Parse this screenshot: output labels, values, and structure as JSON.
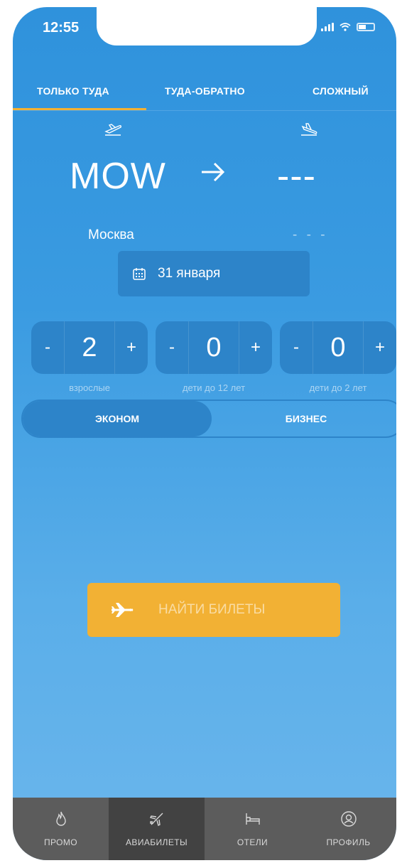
{
  "status_bar": {
    "time": "12:55"
  },
  "tabs": [
    {
      "label": "ТОЛЬКО ТУДА",
      "active": true
    },
    {
      "label": "ТУДА-ОБРАТНО",
      "active": false
    },
    {
      "label": "СЛОЖНЫЙ",
      "active": false
    }
  ],
  "route": {
    "origin_code": "MOW",
    "destination_code": "---",
    "origin_city": "Москва",
    "destination_city": "- - -"
  },
  "date": {
    "label": "31 января"
  },
  "passengers": [
    {
      "minus": "-",
      "value": "2",
      "plus": "+",
      "label": "взрослые"
    },
    {
      "minus": "-",
      "value": "0",
      "plus": "+",
      "label": "дети до 12 лет"
    },
    {
      "minus": "-",
      "value": "0",
      "plus": "+",
      "label": "дети до 2 лет"
    }
  ],
  "travel_class": {
    "econom": "ЭКОНОМ",
    "business": "БИЗНЕС",
    "selected": "econom"
  },
  "search_button": {
    "label": "НАЙТИ БИЛЕТЫ"
  },
  "bottom_nav": [
    {
      "label": "ПРОМО",
      "icon": "fire-icon",
      "active": false
    },
    {
      "label": "АВИАБИЛЕТЫ",
      "icon": "airplane-icon",
      "active": true
    },
    {
      "label": "ОТЕЛИ",
      "icon": "bed-icon",
      "active": false
    },
    {
      "label": "ПРОФИЛЬ",
      "icon": "user-circle-icon",
      "active": false
    }
  ],
  "colors": {
    "background_top": "#2f92dc",
    "background_bottom": "#6bb6ec",
    "accent": "#f2b134",
    "control_fill": "#2d84c9",
    "tabbar": "#5c5c5c",
    "tabbar_active": "#424242"
  }
}
